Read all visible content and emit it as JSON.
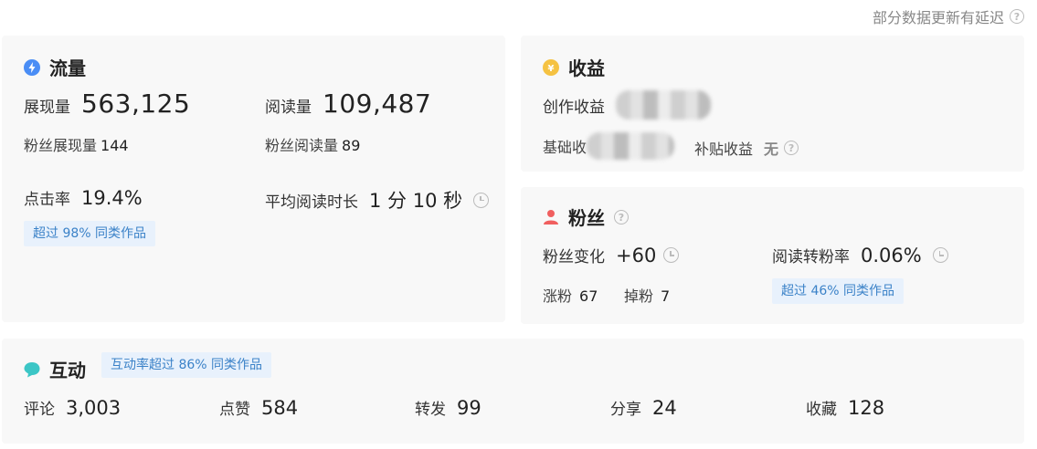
{
  "notice": "部分数据更新有延迟",
  "traffic": {
    "title": "流量",
    "impressions_label": "展现量",
    "impressions_value": "563,125",
    "reads_label": "阅读量",
    "reads_value": "109,487",
    "fan_impressions_label": "粉丝展现量",
    "fan_impressions_value": "144",
    "fan_reads_label": "粉丝阅读量",
    "fan_reads_value": "89",
    "ctr_label": "点击率",
    "ctr_value": "19.4%",
    "avg_read_label": "平均阅读时长",
    "avg_read_value": "1 分 10 秒",
    "ctr_tag": "超过 98% 同类作品"
  },
  "income": {
    "title": "收益",
    "creation_label": "创作收益",
    "base_label": "基础收",
    "subsidy_label": "补贴收益",
    "subsidy_value": "无"
  },
  "fans": {
    "title": "粉丝",
    "change_label": "粉丝变化",
    "change_value": "+60",
    "conversion_label": "阅读转粉率",
    "conversion_value": "0.06%",
    "gain_label": "涨粉",
    "gain_value": "67",
    "loss_label": "掉粉",
    "loss_value": "7",
    "conversion_tag": "超过 46% 同类作品"
  },
  "interaction": {
    "title": "互动",
    "tag": "互动率超过 86% 同类作品",
    "metrics": [
      {
        "label": "评论",
        "value": "3,003"
      },
      {
        "label": "点赞",
        "value": "584"
      },
      {
        "label": "转发",
        "value": "99"
      },
      {
        "label": "分享",
        "value": "24"
      },
      {
        "label": "收藏",
        "value": "128"
      }
    ]
  },
  "colors": {
    "traffic_icon": "#4a8df5",
    "income_icon": "#f5c242",
    "fans_icon": "#f05f5f",
    "interaction_icon": "#3cc6c6",
    "tag_bg": "#e8f1fc",
    "tag_text": "#3b82c8"
  },
  "icons": [
    "lightning-icon",
    "yuan-coin-icon",
    "person-icon",
    "chat-bubble-icon",
    "help-icon",
    "clock-icon"
  ]
}
